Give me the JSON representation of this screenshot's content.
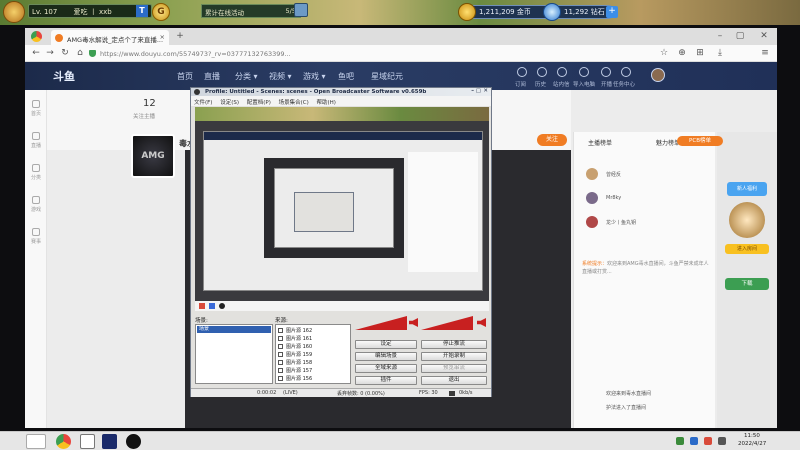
{
  "game_bar": {
    "level": "Lv. 107",
    "player_name": "爱吃 丨 xxb",
    "event": "累计在线活动",
    "event_progress": "5/5",
    "currency1": "1,211,209 金币",
    "currency2": "11,292 钻石"
  },
  "browser": {
    "tab_title": "AMG毒水解说_定点个了来直播...",
    "new_tab": "+",
    "url": "https://www.douyu.com/5574973?_rv=03777132763399..."
  },
  "site": {
    "logo": "斗鱼",
    "nav": [
      "首页",
      "直播",
      "分类 ▾",
      "视频 ▾",
      "游戏 ▾",
      "鱼吧",
      "星域纪元"
    ],
    "header_icons": [
      "订阅",
      "历史",
      "站内信",
      "导入电脑",
      "开播",
      "任务中心"
    ],
    "left_nav": [
      "首页",
      "直播",
      "分类",
      "游戏",
      "赛事"
    ],
    "room": {
      "count": "12",
      "count_label": "关注主播",
      "streamer": "毒水强双",
      "tag": "AMG",
      "follow_btn": "关注"
    },
    "chat": {
      "rank_tab1": "主播榜单",
      "rank_tab2": "魅力榜单",
      "top_fans": [
        "曾经反",
        "Mr8ky",
        "龙少丨鱼丸钥"
      ],
      "notice_label": "系统提示：",
      "notice": "欢迎来到AMG毒水直播间，斗鱼严禁未成年人直播或打赏...",
      "msg1": "欢迎来到毒水直播间",
      "msg2": "护法进入了直播间"
    },
    "right": {
      "btn1": "PCB榜单",
      "btn2": "主播榜单",
      "side_badge": "新人福利",
      "side_label": "进入房间",
      "side_btn": "下载"
    }
  },
  "obs": {
    "title": "Profile: Untitled - Scenes: scenes - Open Broadcaster Software v0.659b",
    "menu": [
      "文件(F)",
      "设定(S)",
      "配置档(P)",
      "场景集合(C)",
      "帮助(H)"
    ],
    "scenes_label": "场景:",
    "sources_label": "来源:",
    "scenes": [
      "场景"
    ],
    "sources": [
      "图片源 162",
      "图片源 161",
      "图片源 160",
      "图片源 159",
      "图片源 158",
      "图片源 157",
      "图片源 156"
    ],
    "buttons": {
      "settings": "设定",
      "stop_stream": "停止推流",
      "edit_scene": "编辑场景",
      "start_record": "开始录制",
      "global_sources": "全域来源",
      "preview_stream": "预览串流",
      "plugins": "插件",
      "exit": "退出"
    },
    "status": {
      "time": "0:00:02",
      "fps_label": "(LIVE)",
      "dropped": "丢弃帧数: 0 (0.00%)",
      "fps": "FPS: 30",
      "bitrate": "0kb/s"
    }
  },
  "taskbar": {
    "time": "11:50",
    "date": "2022/4/27"
  }
}
